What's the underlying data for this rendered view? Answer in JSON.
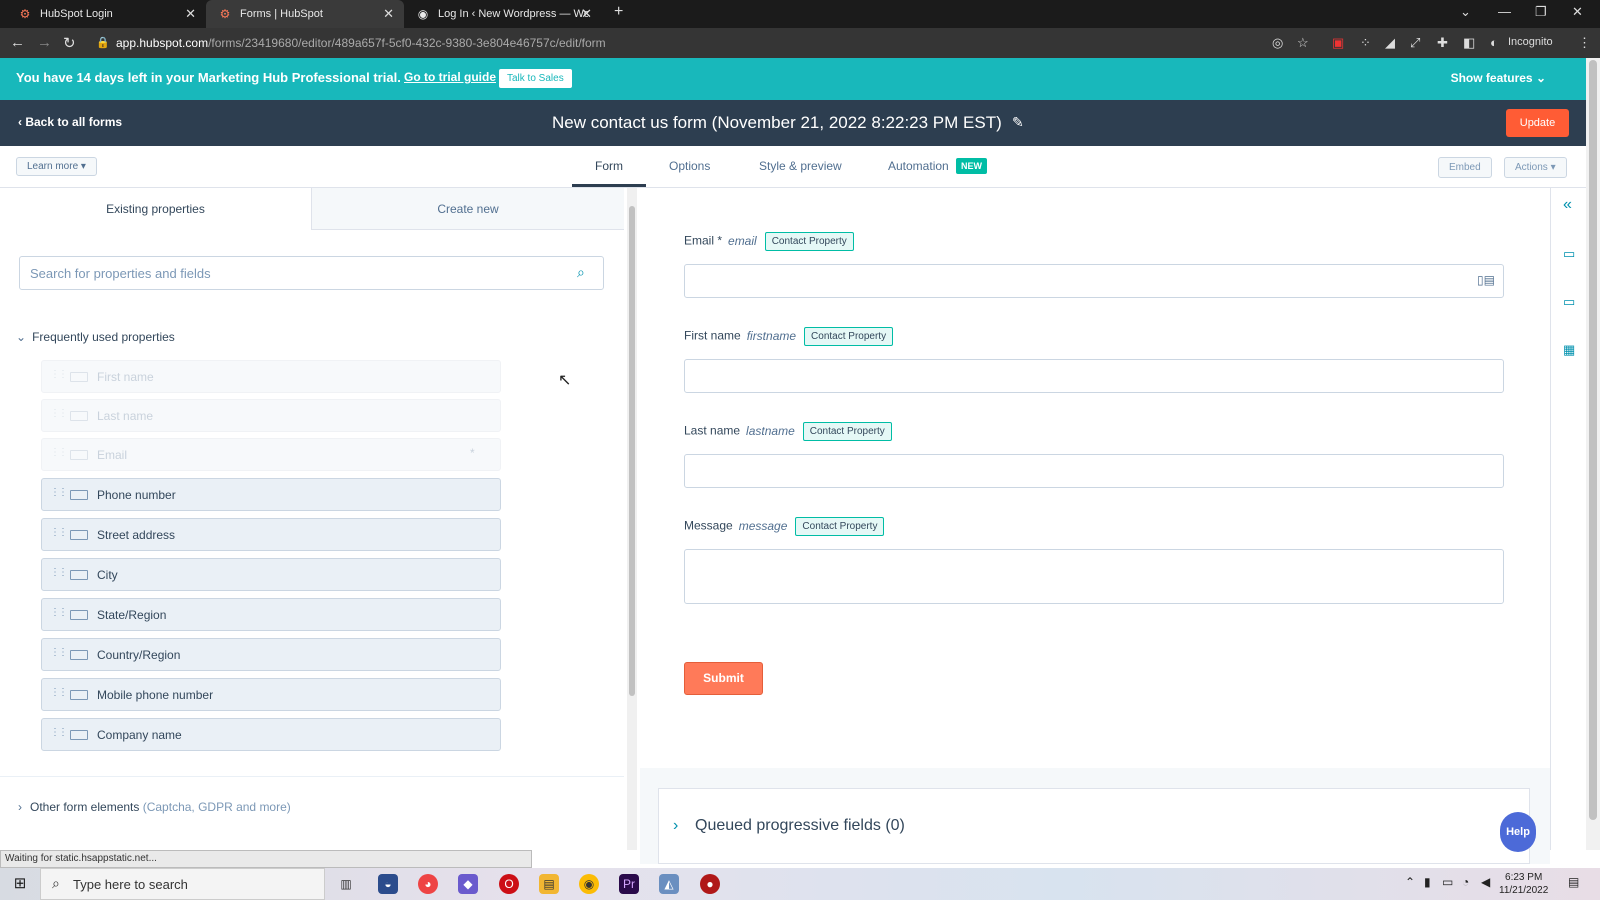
{
  "browser": {
    "tabs": [
      {
        "title": "HubSpot Login"
      },
      {
        "title": "Forms | HubSpot"
      },
      {
        "title": "Log In ‹ New Wordpress — Word"
      }
    ],
    "url_host": "app.hubspot.com",
    "url_path": "/forms/23419680/editor/489a657f-5cf0-432c-9380-3e804e46757c/edit/form",
    "profile": "Incognito"
  },
  "banner": {
    "message": "You have 14 days left in your Marketing Hub Professional trial.",
    "link": "Go to trial guide",
    "button": "Talk to Sales",
    "show_features": "Show features"
  },
  "header": {
    "back": "Back to all forms",
    "title": "New contact us form (November 21, 2022 8:22:23 PM EST)",
    "update": "Update"
  },
  "nav": {
    "learn_more": "Learn more",
    "tabs": [
      "Form",
      "Options",
      "Style & preview",
      "Automation"
    ],
    "new_badge": "NEW",
    "embed": "Embed",
    "actions": "Actions"
  },
  "left": {
    "tabs": [
      "Existing properties",
      "Create new"
    ],
    "search_placeholder": "Search for properties and fields",
    "frequent_header": "Frequently used properties",
    "properties": [
      {
        "label": "First name",
        "disabled": true
      },
      {
        "label": "Last name",
        "disabled": true
      },
      {
        "label": "Email",
        "disabled": true
      },
      {
        "label": "Phone number",
        "disabled": false
      },
      {
        "label": "Street address",
        "disabled": false
      },
      {
        "label": "City",
        "disabled": false
      },
      {
        "label": "State/Region",
        "disabled": false
      },
      {
        "label": "Country/Region",
        "disabled": false
      },
      {
        "label": "Mobile phone number",
        "disabled": false
      },
      {
        "label": "Company name",
        "disabled": false
      }
    ],
    "other_elements": "Other form elements",
    "other_elements_hint": "(Captcha, GDPR and more)"
  },
  "form": {
    "fields": [
      {
        "label": "Email *",
        "internal": "email",
        "badge": "Contact Property"
      },
      {
        "label": "First name",
        "internal": "firstname",
        "badge": "Contact Property"
      },
      {
        "label": "Last name",
        "internal": "lastname",
        "badge": "Contact Property"
      },
      {
        "label": "Message",
        "internal": "message",
        "badge": "Contact Property"
      }
    ],
    "submit": "Submit",
    "queued": "Queued progressive fields (0)"
  },
  "help": "Help",
  "status_text": "Waiting for static.hsappstatic.net...",
  "taskbar": {
    "search_placeholder": "Type here to search",
    "time": "6:23 PM",
    "date": "11/21/2022"
  },
  "colors": {
    "banner": "#18b8bb",
    "header": "#2d3e50",
    "accent_orange": "#ff7a59",
    "teal": "#00bda5",
    "help": "#4c6ad8"
  }
}
